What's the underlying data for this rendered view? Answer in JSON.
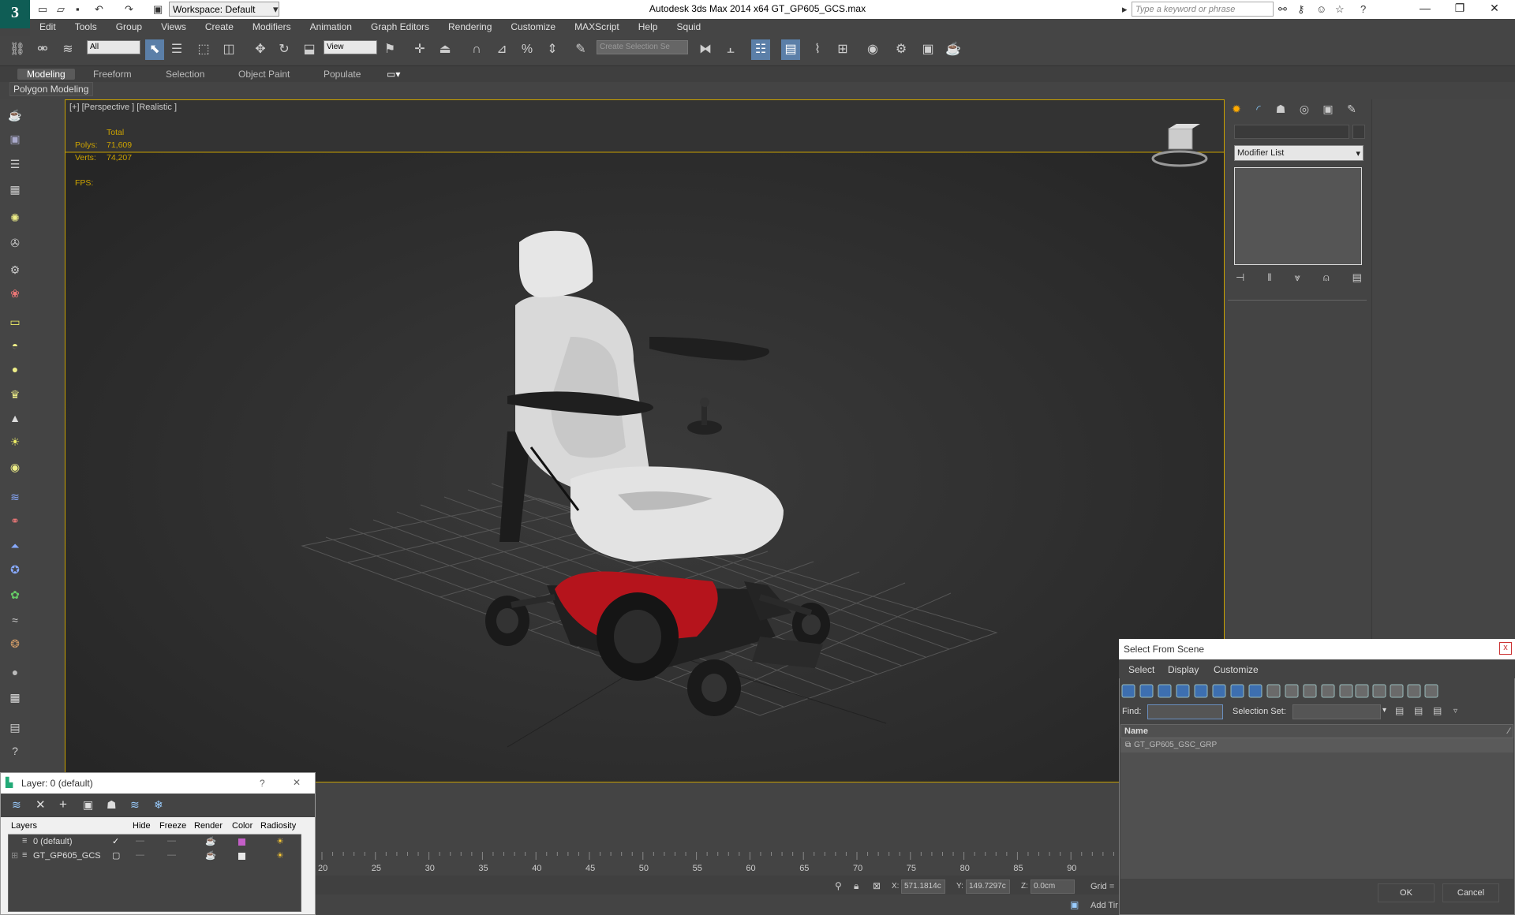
{
  "titlebar": {
    "workspace": "Workspace: Default",
    "app_title": "Autodesk 3ds Max  2014 x64     GT_GP605_GCS.max",
    "search_placeholder": "Type a keyword or phrase",
    "logo": "3"
  },
  "menu": [
    "Edit",
    "Tools",
    "Group",
    "Views",
    "Create",
    "Modifiers",
    "Animation",
    "Graph Editors",
    "Rendering",
    "Customize",
    "MAXScript",
    "Help",
    "Squid"
  ],
  "toolbar": {
    "filter": "All",
    "ref_coord": "View",
    "selection_set": "Create Selection Se"
  },
  "ribbon": {
    "tabs": [
      "Modeling",
      "Freeform",
      "Selection",
      "Object Paint",
      "Populate"
    ],
    "active_panel": "Polygon Modeling"
  },
  "viewport": {
    "label": "[+] [Perspective ] [Realistic ]",
    "stats_header": "Total",
    "polys_label": "Polys:",
    "polys_value": "71,609",
    "verts_label": "Verts:",
    "verts_value": "74,207",
    "fps_label": "FPS:"
  },
  "command_panel": {
    "modifier_list": "Modifier List"
  },
  "timeline": {
    "ticks": [
      "20",
      "25",
      "30",
      "35",
      "40",
      "45",
      "50",
      "55",
      "60",
      "65",
      "70",
      "75",
      "80",
      "85",
      "90"
    ]
  },
  "status": {
    "x_label": "X:",
    "x_value": "571.1814c",
    "y_label": "Y:",
    "y_value": "149.7297c",
    "z_label": "Z:",
    "z_value": "0.0cm",
    "grid_label": "Grid =",
    "add_time": "Add Tir"
  },
  "layer_window": {
    "title": "Layer: 0 (default)",
    "help": "?",
    "close": "✕",
    "columns": [
      "Layers",
      "Hide",
      "Freeze",
      "Render",
      "Color",
      "Radiosity"
    ],
    "rows": [
      {
        "name": "0 (default)",
        "check": "✓"
      },
      {
        "name": "GT_GP605_GCS",
        "check": ""
      }
    ]
  },
  "select_from_scene": {
    "title": "Select From Scene",
    "close": "x",
    "menu": [
      "Select",
      "Display",
      "Customize"
    ],
    "find_label": "Find:",
    "selection_set_label": "Selection Set:",
    "column_name": "Name",
    "items": [
      "GT_GP605_GSC_GRP"
    ],
    "ok": "OK",
    "cancel": "Cancel"
  },
  "colors": {
    "viewport_border": "#c8a000",
    "stats_text": "#cca300",
    "layer_color_0": "#c45fc8",
    "layer_color_1": "#e8e8e8"
  }
}
